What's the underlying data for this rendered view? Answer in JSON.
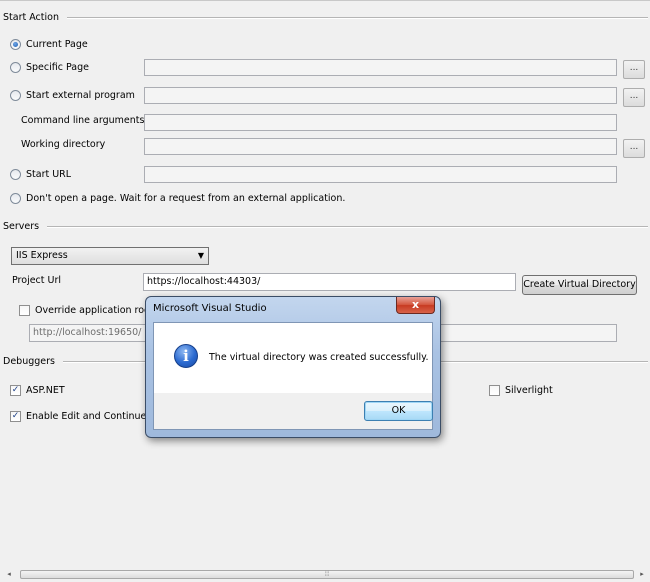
{
  "start_action": {
    "header": "Start Action",
    "current_page": "Current Page",
    "specific_page": "Specific Page",
    "specific_page_value": "",
    "start_external_program": "Start external program",
    "external_program_value": "",
    "command_line_arguments": "Command line arguments",
    "command_line_value": "",
    "working_directory": "Working directory",
    "working_directory_value": "",
    "start_url": "Start URL",
    "start_url_value": "",
    "dont_open": "Don't open a page.  Wait for a request from an external application.",
    "browse_label": "...",
    "selected": "Current Page"
  },
  "servers": {
    "header": "Servers",
    "server_select": "IIS Express",
    "project_url_label": "Project Url",
    "project_url_value": "https://localhost:44303/",
    "create_vdir_button": "Create Virtual Directory",
    "override_label": "Override application root URL",
    "override_checked": false,
    "override_value": "http://localhost:19650/"
  },
  "debuggers": {
    "header": "Debuggers",
    "aspnet": "ASP.NET",
    "aspnet_checked": true,
    "edit_continue": "Enable Edit and Continue",
    "edit_continue_checked": true,
    "silverlight": "Silverlight",
    "silverlight_checked": false
  },
  "dialog": {
    "title": "Microsoft Visual Studio",
    "close_glyph": "x",
    "message": "The virtual directory was created successfully.",
    "ok_button": "OK",
    "icon": "info-icon"
  },
  "scrollbar": {
    "left_arrow": "◂",
    "right_arrow": "▸",
    "grip": "⦙⦙⦙"
  }
}
